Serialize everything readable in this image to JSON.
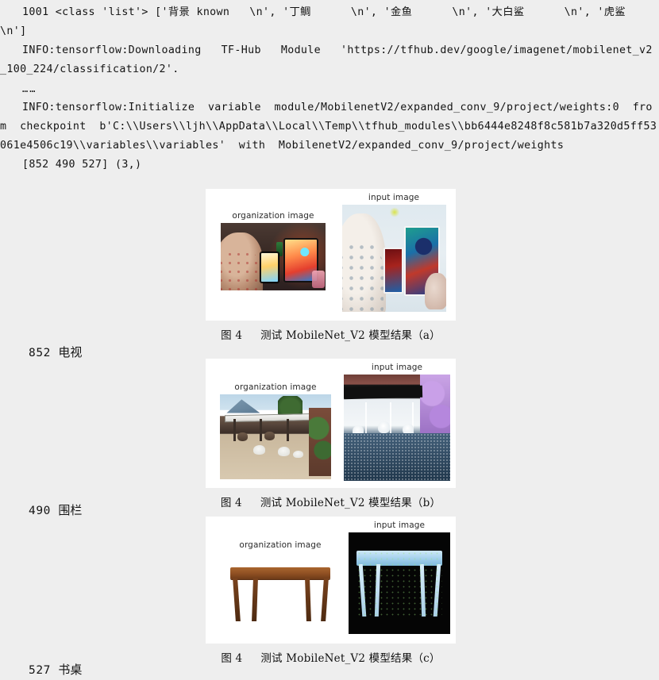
{
  "console": {
    "lines": [
      "1001 <class 'list'> ['背景 known   \\n', '丁鲷      \\n', '金鱼      \\n', '大白鲨      \\n', '虎鲨     \\n']",
      "INFO:tensorflow:Downloading   TF-Hub   Module   'https://tfhub.dev/google/imagenet/mobilenet_v2_100_224/classification/2'.",
      "……",
      "INFO:tensorflow:Initialize  variable  module/MobilenetV2/expanded_conv_9/project/weights:0  from  checkpoint  b'C:\\\\Users\\\\ljh\\\\AppData\\\\Local\\\\Temp\\\\tfhub_modules\\\\bb6444e8248f8c581b7a320d5ff53061e4506c19\\\\variables\\\\variables'  with  MobilenetV2/expanded_conv_9/project/weights",
      "[852 490 527] (3,)"
    ]
  },
  "predictions": [
    {
      "index": "852",
      "label": "电视"
    },
    {
      "index": "490",
      "label": "围栏"
    },
    {
      "index": "527",
      "label": "书桌"
    }
  ],
  "figures": [
    {
      "id": "a",
      "left_title": "organization image",
      "right_title": "input image",
      "caption_prefix": "图 4",
      "caption_text": "测试 MobileNet_V2 模型结果（a）"
    },
    {
      "id": "b",
      "left_title": "organization image",
      "right_title": "input image",
      "caption_prefix": "图 4",
      "caption_text": "测试 MobileNet_V2 模型结果（b）"
    },
    {
      "id": "c",
      "left_title": "organization image",
      "right_title": "input image",
      "caption_prefix": "图 4",
      "caption_text": "测试 MobileNet_V2 模型结果（c）"
    }
  ],
  "colors": {
    "page_background": "#eeeeee",
    "panel_background": "#ffffff",
    "text": "#141414"
  }
}
